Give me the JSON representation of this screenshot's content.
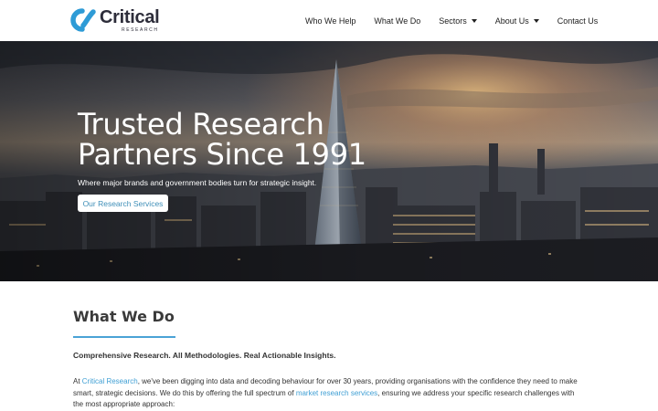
{
  "header": {
    "logo": {
      "word": "Critical",
      "sub": "RESEARCH"
    },
    "nav": [
      {
        "label": "Who We Help",
        "has_dropdown": false
      },
      {
        "label": "What We Do",
        "has_dropdown": false
      },
      {
        "label": "Sectors",
        "has_dropdown": true
      },
      {
        "label": "About Us",
        "has_dropdown": true
      },
      {
        "label": "Contact Us",
        "has_dropdown": false
      }
    ]
  },
  "hero": {
    "title_line1": "Trusted Research",
    "title_line2": "Partners Since 1991",
    "subtitle": "Where major brands and government bodies turn for strategic insight.",
    "button_label": "Our Research Services"
  },
  "what_we_do": {
    "title": "What We Do",
    "tagline": "Comprehensive Research. All Methodologies. Real Actionable Insights.",
    "para_1": "At ",
    "link_company": "Critical Research",
    "para_2": ", we've been digging into data and decoding behaviour for over 30 years, providing organisations with the confidence they need to make smart, strategic decisions. We do this by offering the full spectrum of ",
    "link_services": "market research services",
    "para_3": ", ensuring we address your specific research challenges with the most appropriate approach:"
  },
  "colors": {
    "accent": "#4aa3d6",
    "link": "#3f9fd4",
    "logo_blue": "#2e9bd6",
    "text_dark": "#333333"
  }
}
